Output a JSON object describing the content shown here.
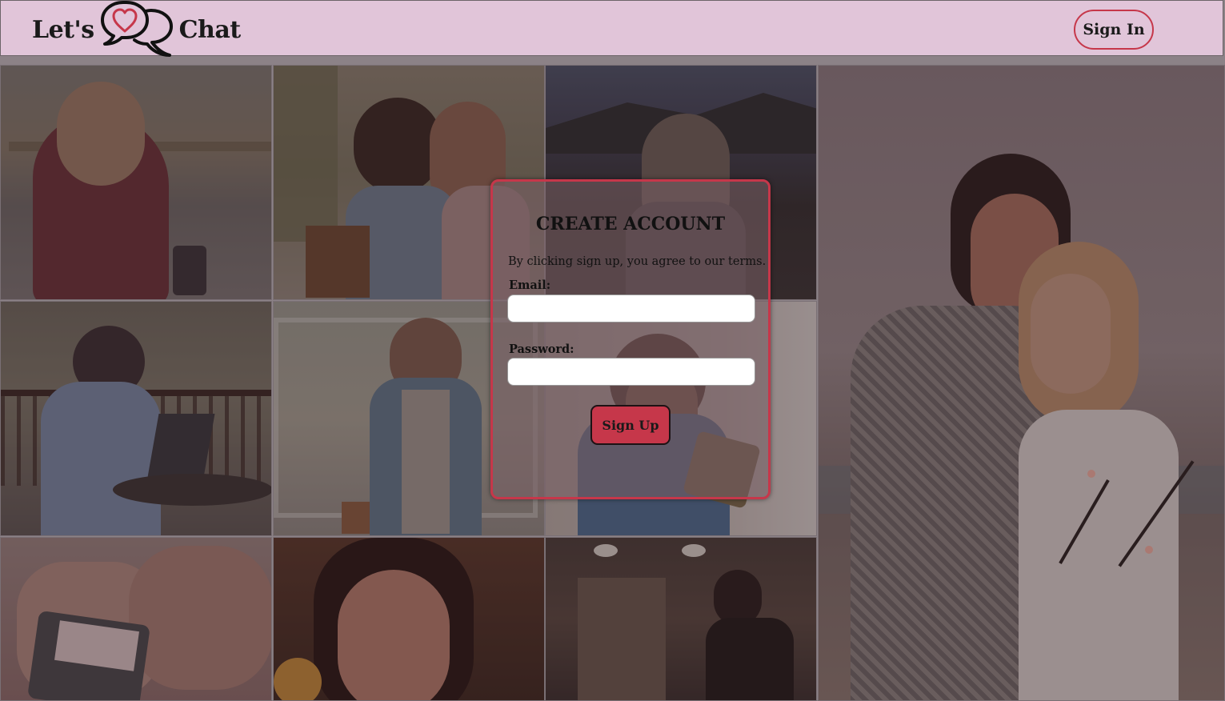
{
  "header": {
    "logo_left": "Let's",
    "logo_right": "Chat",
    "logo_icon": "chat-bubbles-heart-icon",
    "signin_label": "Sign In"
  },
  "colors": {
    "nav_bg": "#e1c5d9",
    "accent": "#c6374a",
    "overlay": "#7a5f66"
  },
  "gallery": {
    "photos": [
      "person-with-phone-at-station",
      "two-friends-looking-at-phone",
      "woman-with-phone-at-dusk",
      "man-with-laptop-on-porch",
      "man-texting-indoors",
      "woman-smiling-at-phone",
      "hands-holding-phone",
      "girl-lit-by-phone-screen",
      "man-with-phone-in-cafe",
      "couple-with-sparklers-on-beach"
    ]
  },
  "modal": {
    "title": "CREATE ACCOUNT",
    "terms": "By clicking sign up, you agree to our terms.",
    "email_label": "Email:",
    "email_value": "",
    "password_label": "Password:",
    "password_value": "",
    "submit_label": "Sign Up"
  }
}
